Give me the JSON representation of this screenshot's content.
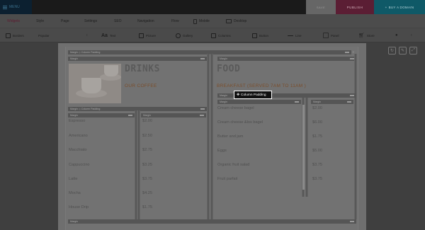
{
  "topbar": {
    "menu_label": "MENU",
    "save_label": "SAVE",
    "publish_label": "PUBLISH",
    "domain_label": "BUY A DOMAIN"
  },
  "nav": {
    "tabs": [
      {
        "label": "Widgets",
        "active": true
      },
      {
        "label": "Style"
      },
      {
        "label": "Page"
      },
      {
        "label": "Settings"
      },
      {
        "label": "SEO"
      },
      {
        "label": "Navigation"
      },
      {
        "label": "Flow"
      },
      {
        "label": "Mobile"
      },
      {
        "label": "Desktop"
      }
    ]
  },
  "toolbar": {
    "borders_label": "Borders",
    "preset_label": "Popular",
    "text_label": "Text",
    "picture_label": "Picture",
    "gallery_label": "Gallery",
    "columns_label": "Columns",
    "button_label": "Button",
    "line_label": "Line",
    "panel_label": "Panel",
    "store_label": "Store"
  },
  "structure": {
    "margin_label": "Margin",
    "margin_col_label": "Margin ◇ Column Padding",
    "tooltip_label": "Column Padding"
  },
  "drinks": {
    "title": "DRINKS",
    "subtitle": "OUR COFFEE",
    "items": [
      "Espresso",
      "Americano",
      "Macchiato",
      "Cappuccino",
      "Latte",
      "Mocha",
      "House Drip"
    ],
    "prices": [
      "$2.00",
      "$2.50",
      "$2.75",
      "$3.25",
      "$3.75",
      "$4.25",
      "$1.75"
    ]
  },
  "food": {
    "title": "FOOD",
    "subtitle": "BREAKFAST (SERVED 7AM TO 11AM )",
    "items": [
      "Cream cheese bagel",
      "Cream cheese &lox bagel",
      "Butter and jam",
      "Eggs",
      "Organic fruit salad",
      "Fruit parfait"
    ],
    "prices": [
      "$2.00",
      "$6.00",
      "$1.75",
      "$5.00",
      "$3.75",
      "$3.75"
    ]
  },
  "colors": {
    "publish": "#5b1e34",
    "domain": "#0f5967",
    "accent_subtitle": "#7a4d2b"
  }
}
